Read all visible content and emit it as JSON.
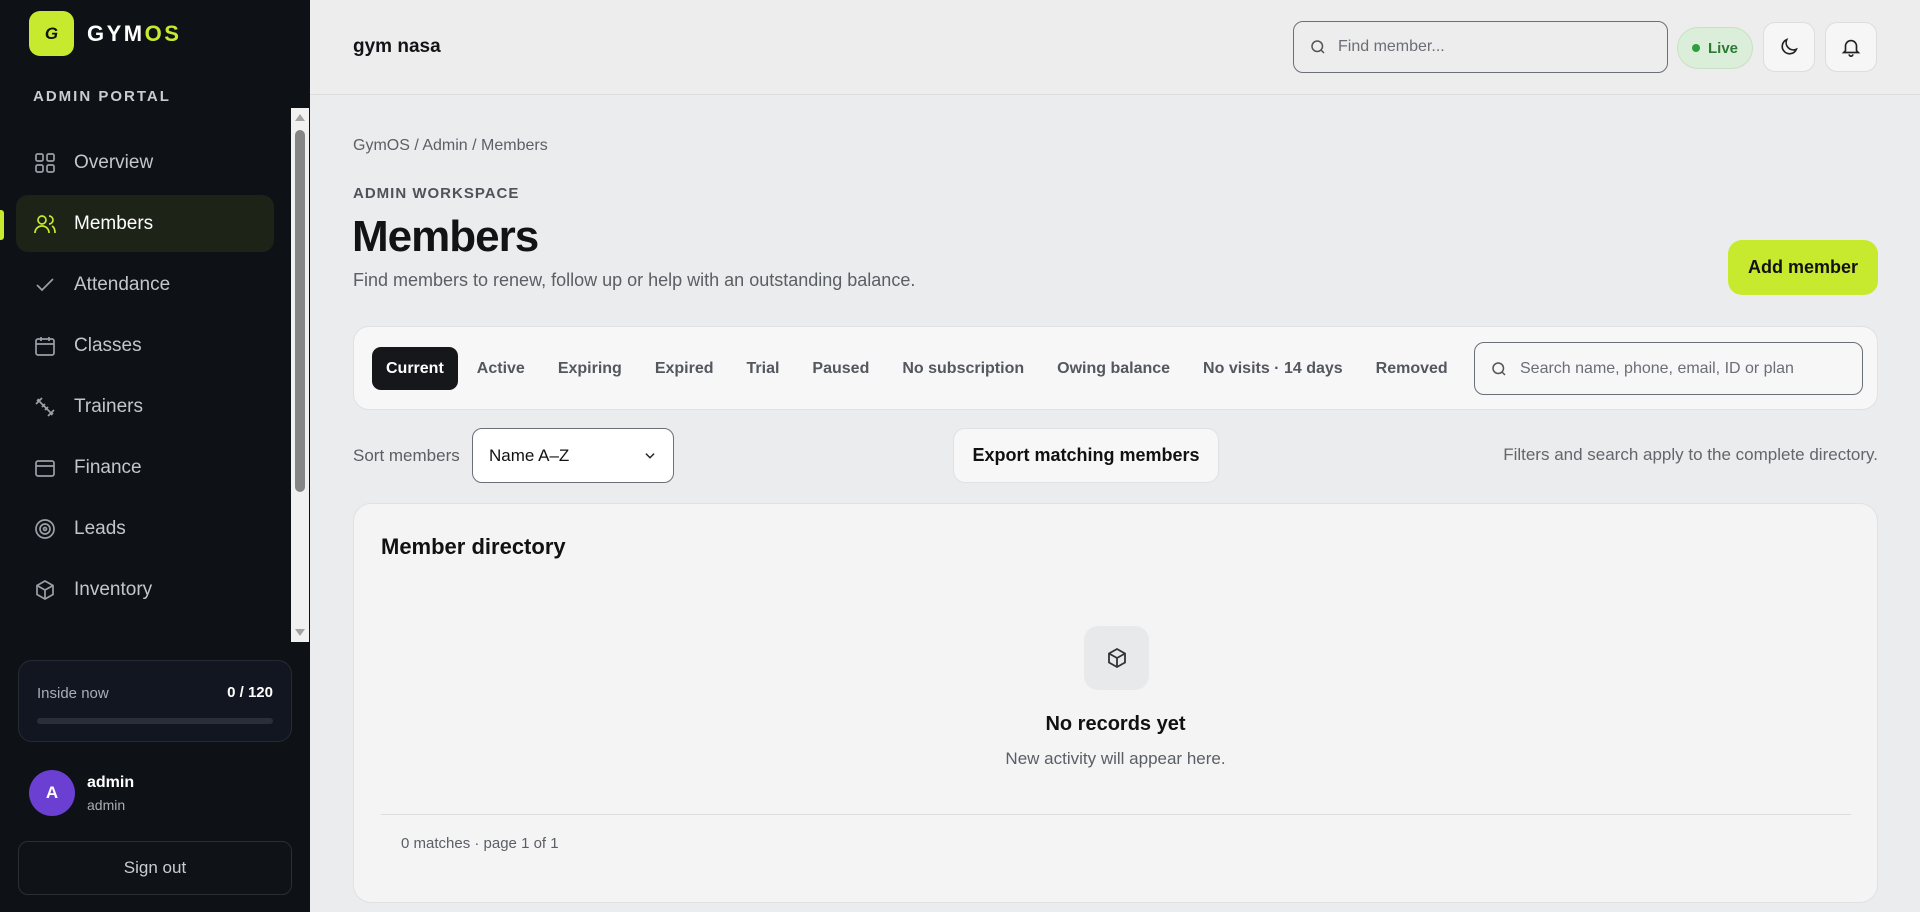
{
  "brand": {
    "logo_letter": "G",
    "name_main": "GYM",
    "name_accent": "OS",
    "accent_color": "#c7ea2f"
  },
  "sidebar": {
    "portal_label": "ADMIN PORTAL",
    "items": [
      {
        "label": "Overview",
        "icon": "grid-icon"
      },
      {
        "label": "Members",
        "icon": "users-icon",
        "active": true
      },
      {
        "label": "Attendance",
        "icon": "check-icon"
      },
      {
        "label": "Classes",
        "icon": "calendar-icon"
      },
      {
        "label": "Trainers",
        "icon": "dumbbell-icon"
      },
      {
        "label": "Finance",
        "icon": "wallet-icon"
      },
      {
        "label": "Leads",
        "icon": "target-icon"
      },
      {
        "label": "Inventory",
        "icon": "box-icon"
      }
    ],
    "occupancy": {
      "label": "Inside now",
      "count": "0 / 120",
      "fraction": 0
    },
    "user": {
      "initial": "A",
      "name": "admin",
      "role": "admin"
    },
    "signout_label": "Sign out"
  },
  "topbar": {
    "gym_name": "gym nasa",
    "search_placeholder": "Find member...",
    "live_label": "Live"
  },
  "main": {
    "breadcrumb": "GymOS / Admin / Members",
    "eyebrow": "ADMIN WORKSPACE",
    "title": "Members",
    "subtitle": "Find members to renew, follow up or help with an outstanding balance.",
    "add_member_label": "Add member",
    "tabs": [
      {
        "label": "Current",
        "active": true
      },
      {
        "label": "Active"
      },
      {
        "label": "Expiring"
      },
      {
        "label": "Expired"
      },
      {
        "label": "Trial"
      },
      {
        "label": "Paused"
      },
      {
        "label": "No subscription"
      },
      {
        "label": "Owing balance"
      },
      {
        "label": "No visits · 14 days"
      },
      {
        "label": "Removed"
      }
    ],
    "filter_search_placeholder": "Search name, phone, email, ID or plan",
    "sort_label": "Sort members",
    "sort_value": "Name A–Z",
    "export_label": "Export matching members",
    "filters_note": "Filters and search apply to the complete directory.",
    "directory": {
      "title": "Member directory",
      "empty_title": "No records yet",
      "empty_subtitle": "New activity will appear here.",
      "pager": "0 matches · page 1 of 1"
    }
  }
}
